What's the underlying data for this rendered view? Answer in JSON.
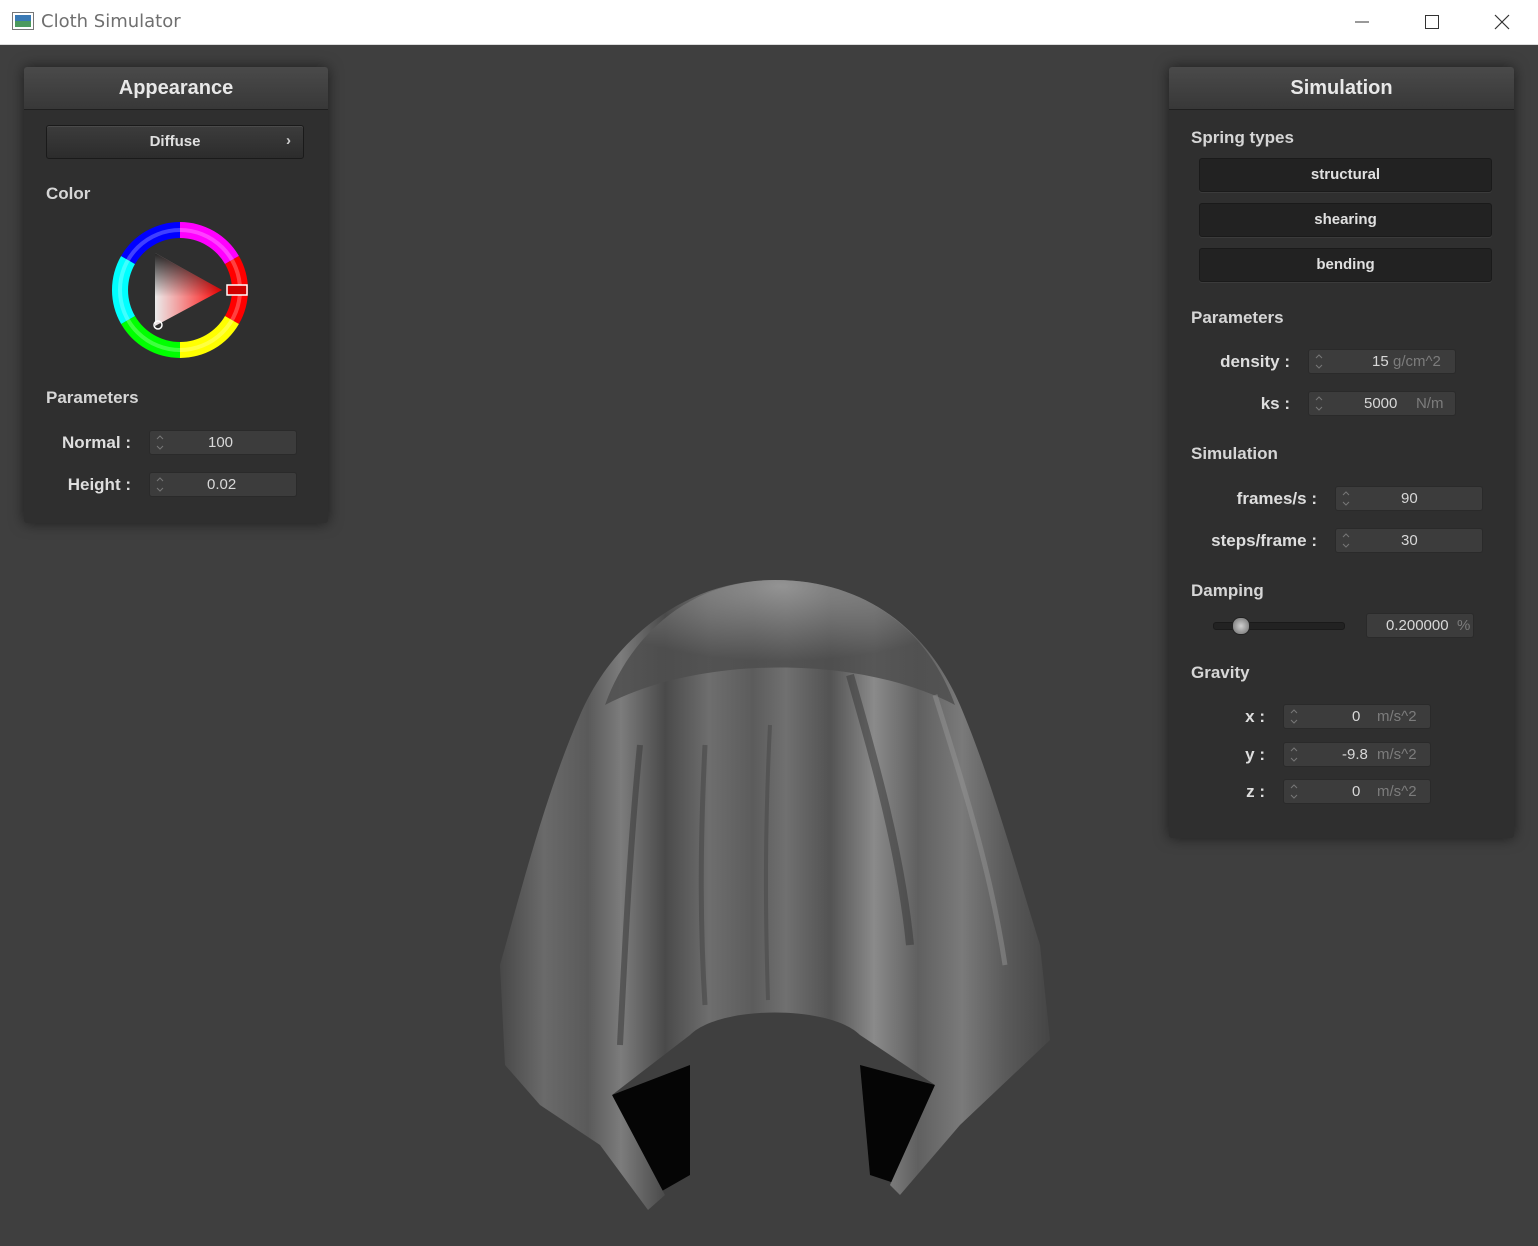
{
  "window": {
    "title": "Cloth Simulator"
  },
  "appearance": {
    "title": "Appearance",
    "shader_dropdown": "Diffuse",
    "color_label": "Color",
    "color": {
      "hue_hex": "#ff0000",
      "picked_hex": "#ffffff"
    },
    "params_label": "Parameters",
    "normal": {
      "label": "Normal :",
      "value": "100"
    },
    "height": {
      "label": "Height :",
      "value": "0.02"
    }
  },
  "simulation": {
    "title": "Simulation",
    "spring_types_label": "Spring types",
    "spring_types": [
      "structural",
      "shearing",
      "bending"
    ],
    "params_label": "Parameters",
    "density": {
      "label": "density :",
      "value": "15",
      "unit": "g/cm^2"
    },
    "ks": {
      "label": "ks :",
      "value": "5000",
      "unit": "N/m"
    },
    "sim_label": "Simulation",
    "fps": {
      "label": "frames/s :",
      "value": "90"
    },
    "steps": {
      "label": "steps/frame :",
      "value": "30"
    },
    "damping_label": "Damping",
    "damping": {
      "value": "0.200000",
      "unit": "%",
      "level": 0.2
    },
    "gravity_label": "Gravity",
    "gravity": [
      {
        "label": "x :",
        "value": "0",
        "unit": "m/s^2"
      },
      {
        "label": "y :",
        "value": "-9.8",
        "unit": "m/s^2"
      },
      {
        "label": "z :",
        "value": "0",
        "unit": "m/s^2"
      }
    ]
  }
}
